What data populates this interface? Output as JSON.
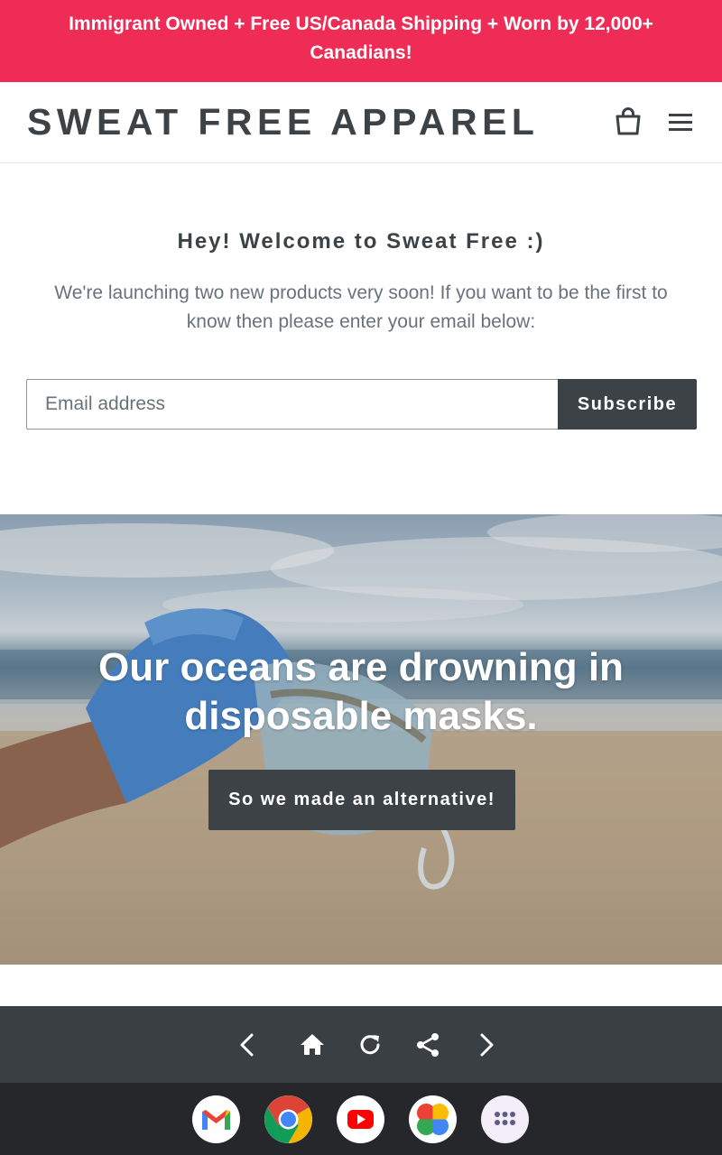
{
  "announcement": {
    "text": "Immigrant Owned + Free US/Canada Shipping + Worn by 12,000+ Canadians!"
  },
  "header": {
    "logo": "SWEAT FREE APPAREL",
    "cart_icon": "shopping-bag-icon",
    "menu_icon": "hamburger-menu-icon"
  },
  "newsletter": {
    "title": "Hey! Welcome to Sweat Free :)",
    "text": "We're launching two new products very soon! If you want to be the first to know then please enter your email below:",
    "email_placeholder": "Email address",
    "email_value": "",
    "button_label": "Subscribe"
  },
  "hero": {
    "title": "Our oceans are drowning in disposable masks.",
    "button_label": "So we made an alternative!"
  },
  "browser_nav": {
    "back_icon": "chevron-left-icon",
    "home_icon": "home-icon",
    "reload_icon": "reload-icon",
    "share_icon": "share-icon",
    "forward_icon": "chevron-right-icon"
  },
  "dock": {
    "apps": [
      "gmail-icon",
      "chrome-icon",
      "youtube-icon",
      "google-photos-icon",
      "app-drawer-icon"
    ]
  },
  "colors": {
    "announcement_bg": "#ee2c55",
    "text_dark": "#3d4246",
    "text_muted": "#69727b",
    "button_bg": "#3d4246",
    "browser_bar_bg": "#3a3f44",
    "dock_bg": "#26272b"
  }
}
